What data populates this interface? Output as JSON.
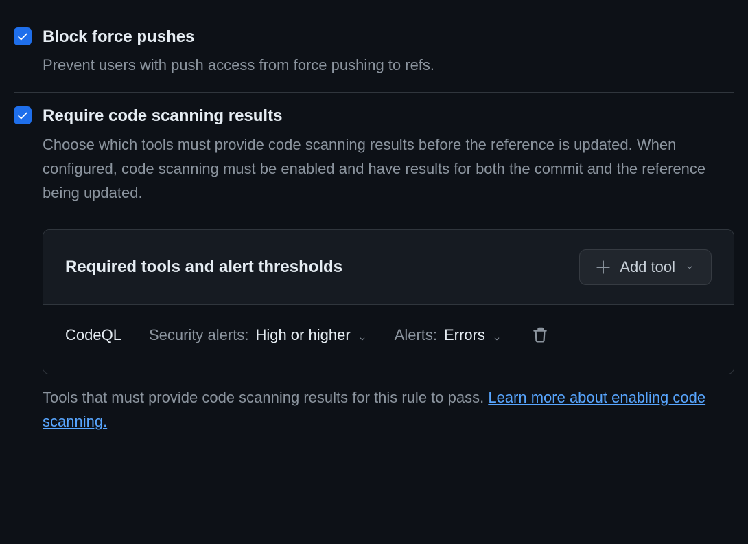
{
  "settings": {
    "block_force_pushes": {
      "title": "Block force pushes",
      "description": "Prevent users with push access from force pushing to refs.",
      "checked": true
    },
    "require_code_scanning": {
      "title": "Require code scanning results",
      "description": "Choose which tools must provide code scanning results before the reference is updated. When configured, code scanning must be enabled and have results for both the commit and the reference being updated.",
      "checked": true,
      "panel": {
        "title": "Required tools and alert thresholds",
        "add_tool_label": "Add tool",
        "tools": [
          {
            "name": "CodeQL",
            "security_alerts_label": "Security alerts:",
            "security_alerts_value": "High or higher",
            "alerts_label": "Alerts:",
            "alerts_value": "Errors"
          }
        ],
        "footer_text": "Tools that must provide code scanning results for this rule to pass. ",
        "footer_link_text": "Learn more about enabling code scanning."
      }
    }
  }
}
